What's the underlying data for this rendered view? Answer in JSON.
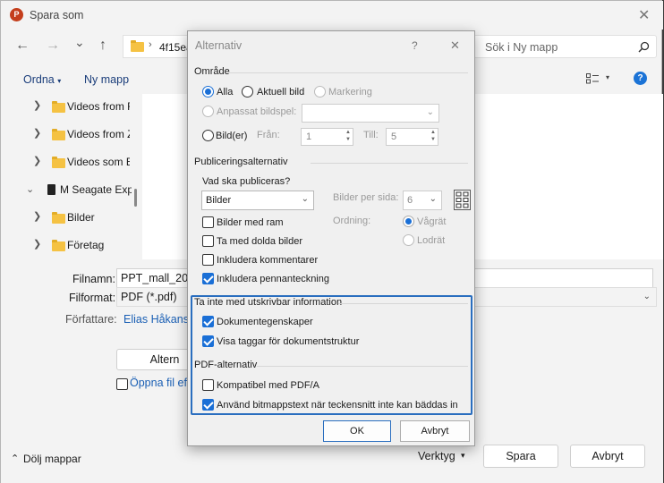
{
  "window": {
    "title": "Spara som",
    "close": "✕"
  },
  "nav": {
    "back": "←",
    "forward": "→",
    "down": "⌄",
    "up": "↑",
    "path": "4f15ea",
    "search_placeholder": "Sök i Ny mapp"
  },
  "cmd": {
    "organize": "Ordna",
    "new_folder": "Ny mapp",
    "view_arrow": "▾",
    "help": "?"
  },
  "tree": [
    {
      "label": "Videos from F",
      "kind": "folder"
    },
    {
      "label": "Videos from Z",
      "kind": "folder"
    },
    {
      "label": "Videos som B",
      "kind": "folder"
    },
    {
      "label": "M Seagate Exp",
      "kind": "drive"
    },
    {
      "label": "Bilder",
      "kind": "folder"
    },
    {
      "label": "Företag",
      "kind": "folder"
    }
  ],
  "form": {
    "filename_label": "Filnamn:",
    "filename_value": "PPT_mall_2022_",
    "format_label": "Filformat:",
    "format_value": "PDF (*.pdf)",
    "author_label": "Författare:",
    "author_value": "Elias Håkansso",
    "altern_button": "Altern",
    "open_after": "Öppna fil efte",
    "hide_folders": "Dölj mappar",
    "tools": "Verktyg",
    "save": "Spara",
    "cancel": "Avbryt"
  },
  "dialog": {
    "title": "Alternativ",
    "help": "?",
    "close": "✕",
    "range_group": "Område",
    "range_all": "Alla",
    "range_current": "Aktuell bild",
    "range_selection": "Markering",
    "range_custom": "Anpassat bildspel:",
    "range_slides": "Bild(er)",
    "from_label": "Från:",
    "from_value": "1",
    "to_label": "Till:",
    "to_value": "5",
    "publish_group": "Publiceringsalternativ",
    "what_label": "Vad ska publiceras?",
    "what_value": "Bilder",
    "per_page_label": "Bilder per sida:",
    "per_page_value": "6",
    "order_label": "Ordning:",
    "order_horizontal": "Vågrät",
    "order_vertical": "Lodrät",
    "frame": "Bilder med ram",
    "hidden": "Ta med dolda bilder",
    "comments": "Inkludera kommentarer",
    "ink": "Inkludera pennanteckning",
    "nonprint_group": "Ta inte med utskrivbar information",
    "doc_props": "Dokumentegenskaper",
    "struct_tags": "Visa taggar för dokumentstruktur",
    "pdf_group": "PDF-alternativ",
    "pdfa": "Kompatibel med PDF/A",
    "bitmap": "Använd bitmappstext när teckensnitt inte kan bäddas in",
    "ok": "OK",
    "cancel": "Avbryt"
  },
  "colors": {
    "accent": "#1a6fd6",
    "highlight_border": "#2a6ebf",
    "folder": "#f5c243"
  }
}
